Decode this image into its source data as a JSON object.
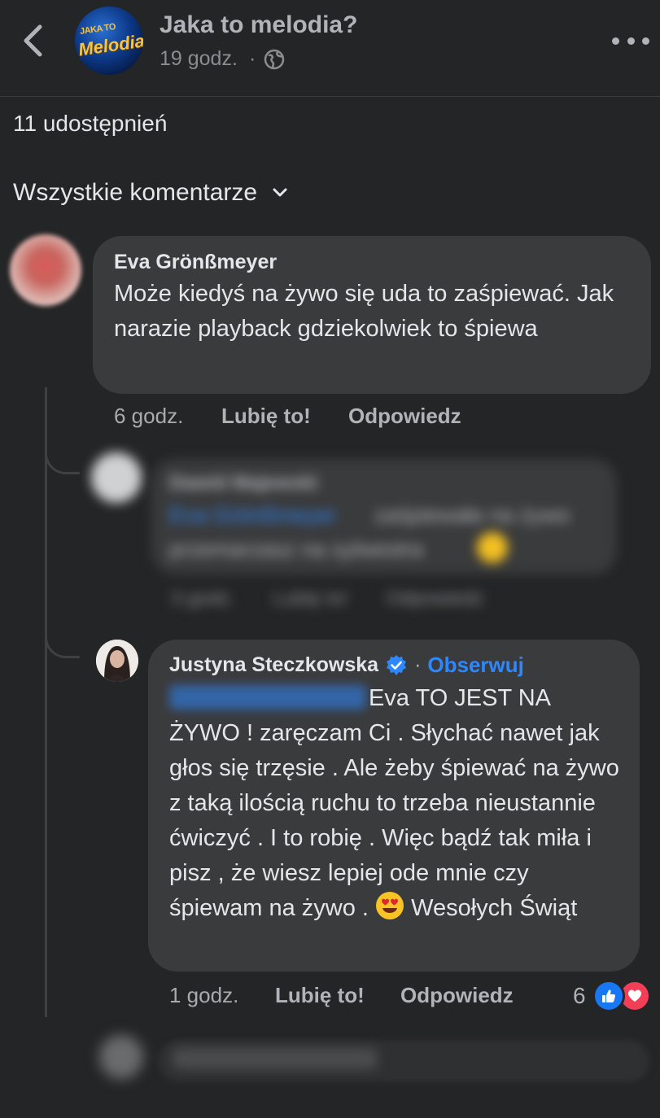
{
  "header": {
    "page_name": "Jaka to melodia?",
    "time": "19 godz.",
    "dot": "·",
    "logo_line1": "JAKA TO",
    "logo_line2": "Melodia?"
  },
  "shares": "11 udostępnień",
  "filter_label": "Wszystkie komentarze",
  "comments": [
    {
      "author": "Eva Grönßmeyer",
      "text": "Może kiedyś na żywo się uda to zaśpiewać. Jak narazie playback gdziekolwiek to śpiewa",
      "time": "6 godz.",
      "like": "Lubię to!",
      "reply": "Odpowiedz"
    }
  ],
  "replies": [
    {
      "author": "Dawid Majewski",
      "mention": "Eva Grönßmeyer",
      "text_line1": "zaśpiewała na żywo",
      "text_line2": "przemarzasz na sylwestra",
      "time": "3 godz.",
      "like": "Lubię to!",
      "reply": "Odpowiedz"
    },
    {
      "author": "Justyna Steczkowska",
      "dot": "·",
      "follow": "Obserwuj",
      "text_part1": "Eva TO JEST NA ŻYWO ! zaręczam Ci . Słychać nawet jak głos się trzęsie . Ale żeby śpiewać na żywo z taką ilością ruchu to trzeba nieustannie ćwiczyć . I to robię . Więc bądź tak miła i pisz , że wiesz lepiej ode mnie czy śpiewam na żywo .",
      "text_part2": "Wesołych Świąt",
      "time": "1 godz.",
      "like": "Lubię to!",
      "reply": "Odpowiedz",
      "reaction_count": "6"
    }
  ],
  "colors": {
    "background": "#242526",
    "bubble": "#3a3b3c",
    "link": "#2d88ff",
    "like_reaction": "#1877f2",
    "love_reaction": "#f33e58"
  },
  "icons": [
    "back-arrow-icon",
    "globe-icon",
    "more-icon",
    "chevron-down-icon",
    "verified-badge-icon",
    "heart-eyes-emoji-icon",
    "like-reaction-icon",
    "love-reaction-icon"
  ]
}
